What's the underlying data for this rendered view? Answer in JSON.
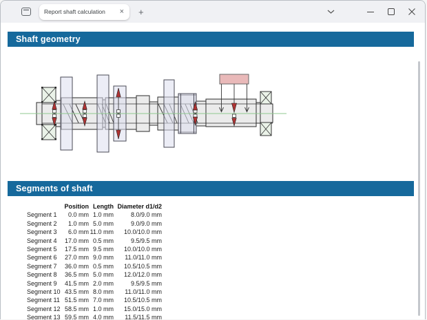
{
  "titlebar": {
    "tab": {
      "title": "Report shaft calculation",
      "close_icon": "×"
    },
    "new_tab_icon": "+",
    "icons": {
      "tab_actions": "tab-overview-icon",
      "chevron": "chevron-down-icon",
      "minimize": "minimize-icon",
      "maximize": "maximize-icon",
      "close": "close-icon"
    }
  },
  "sections": {
    "geometry_title": "Shaft geometry",
    "segments_title": "Segments of shaft"
  },
  "segments_table": {
    "columns": [
      "Position",
      "Length",
      "Diameter d1/d2"
    ],
    "rows": [
      [
        "Segment 1",
        "0.0 mm",
        "1.0 mm",
        "8.0/9.0 mm"
      ],
      [
        "Segment 2",
        "1.0 mm",
        "5.0 mm",
        "9.0/9.0 mm"
      ],
      [
        "Segment 3",
        "6.0 mm",
        "11.0 mm",
        "10.0/10.0 mm"
      ],
      [
        "Segment 4",
        "17.0 mm",
        "0.5 mm",
        "9.5/9.5 mm"
      ],
      [
        "Segment 5",
        "17.5 mm",
        "9.5 mm",
        "10.0/10.0 mm"
      ],
      [
        "Segment 6",
        "27.0 mm",
        "9.0 mm",
        "11.0/11.0 mm"
      ],
      [
        "Segment 7",
        "36.0 mm",
        "0.5 mm",
        "10.5/10.5 mm"
      ],
      [
        "Segment 8",
        "36.5 mm",
        "5.0 mm",
        "12.0/12.0 mm"
      ],
      [
        "Segment 9",
        "41.5 mm",
        "2.0 mm",
        "9.5/9.5 mm"
      ],
      [
        "Segment 10",
        "43.5 mm",
        "8.0 mm",
        "11.0/11.0 mm"
      ],
      [
        "Segment 11",
        "51.5 mm",
        "7.0 mm",
        "10.5/10.5 mm"
      ],
      [
        "Segment 12",
        "58.5 mm",
        "1.0 mm",
        "15.0/15.0 mm"
      ],
      [
        "Segment 13",
        "59.5 mm",
        "4.0 mm",
        "11.5/11.5 mm"
      ]
    ]
  },
  "drawing": {
    "type": "shaft-side-view",
    "features": [
      "left-rolling-bearing",
      "right-rolling-bearing",
      "gears",
      "coupling-hub",
      "distributed-load",
      "radial-force-arrows",
      "centerline",
      "spline-hatching"
    ],
    "colors": {
      "shaft_fill": "#ebebeb",
      "gear_fill": "#dcdfee",
      "bearing_fill": "#eaf2e8",
      "load_fill": "#e9b9b9",
      "force_red": "#b03434",
      "centerline_green": "#8fc98f",
      "outline": "#2b2b2b"
    }
  },
  "colors": {
    "header_bg": "#16699c",
    "header_text": "#ffffff",
    "titlebar_bg": "#f0f1f4",
    "window_border": "#b9bec4",
    "body_text": "#222222"
  }
}
